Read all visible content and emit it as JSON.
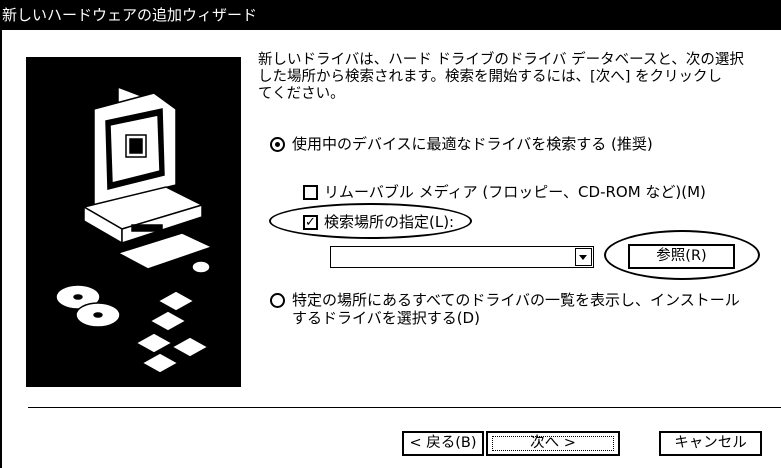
{
  "window": {
    "title": "新しいハードウェアの追加ウィザード"
  },
  "description": "新しいドライバは、ハード ドライブのドライバ データベースと、次の選択\nした場所から検索されます。検索を開始するには、[次へ] をクリックし\nてください。",
  "options": {
    "search_best": {
      "label": "使用中のデバイスに最適なドライバを検索する (推奨)",
      "selected": true
    },
    "removable_media": {
      "label": "リムーバブル メディア (フロッピー、CD-ROM など)(M)",
      "checked": false
    },
    "specify_location": {
      "label": "検索場所の指定(L):",
      "checked": true,
      "check_glyph": "✓"
    },
    "location_value": "",
    "browse_label": "参照(R)",
    "show_list": {
      "label": "特定の場所にあるすべてのドライバの一覧を表示し、インストール\nするドライバを選択する(D)",
      "selected": false
    }
  },
  "buttons": {
    "back": "< 戻る(B)",
    "next": "次へ >",
    "cancel": "キャンセル"
  }
}
